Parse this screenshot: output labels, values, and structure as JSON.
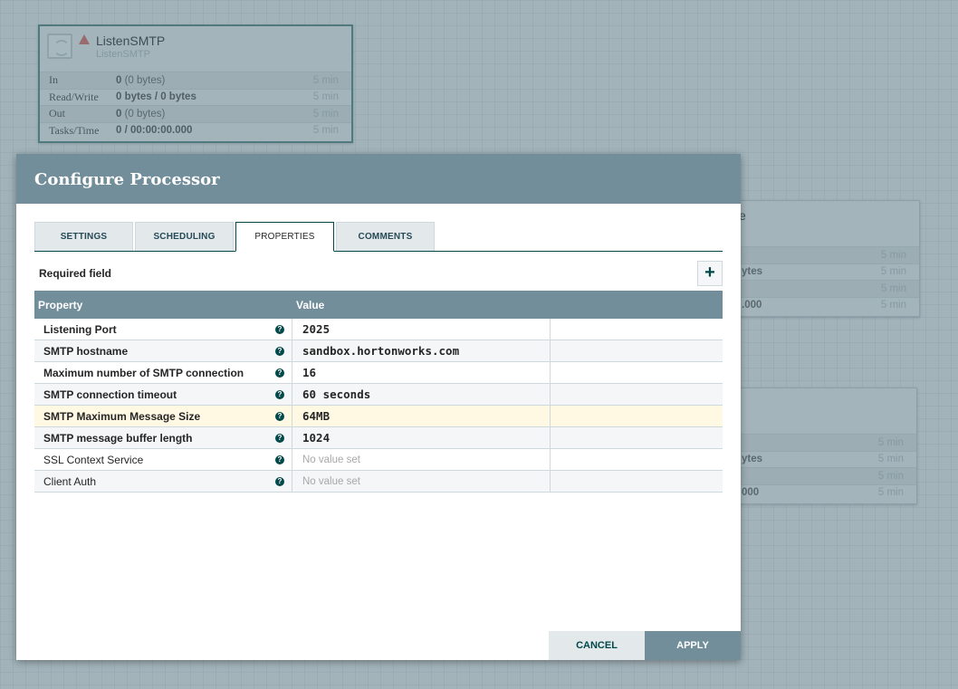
{
  "canvas": {
    "processors": [
      {
        "name": "ListenSMTP",
        "type": "ListenSMTP",
        "warning": true,
        "stats": [
          {
            "label": "In",
            "value_bold": "0",
            "value_rest": " (0 bytes)",
            "time": "5 min"
          },
          {
            "label": "Read/Write",
            "value_bold": "0 bytes / 0 bytes",
            "value_rest": "",
            "time": "5 min"
          },
          {
            "label": "Out",
            "value_bold": "0",
            "value_rest": " (0 bytes)",
            "time": "5 min"
          },
          {
            "label": "Tasks/Time",
            "value_bold": "0 / 00:00:00.000",
            "value_rest": "",
            "time": "5 min"
          }
        ]
      },
      {
        "name_fragment": "e",
        "stats": [
          {
            "value": "",
            "time": "5 min"
          },
          {
            "value": "ytes",
            "time": "5 min"
          },
          {
            "value": "",
            "time": "5 min"
          },
          {
            "value": ".000",
            "time": "5 min"
          }
        ]
      },
      {
        "stats": [
          {
            "value": "",
            "time": "5 min"
          },
          {
            "value": "ytes",
            "time": "5 min"
          },
          {
            "value": "",
            "time": "5 min"
          },
          {
            "value": "000",
            "time": "5 min"
          }
        ]
      }
    ]
  },
  "dialog": {
    "title": "Configure Processor",
    "tabs": [
      {
        "label": "SETTINGS",
        "active": false
      },
      {
        "label": "SCHEDULING",
        "active": false
      },
      {
        "label": "PROPERTIES",
        "active": true
      },
      {
        "label": "COMMENTS",
        "active": false
      }
    ],
    "required_label": "Required field",
    "add_icon": "+",
    "grid": {
      "headers": {
        "property": "Property",
        "value": "Value"
      },
      "help_glyph": "?",
      "rows": [
        {
          "name": "Listening Port",
          "value": "2025",
          "required": true
        },
        {
          "name": "SMTP hostname",
          "value": "sandbox.hortonworks.com",
          "required": true
        },
        {
          "name": "Maximum number of SMTP connection",
          "value": "16",
          "required": true
        },
        {
          "name": "SMTP connection timeout",
          "value": "60 seconds",
          "required": true
        },
        {
          "name": "SMTP Maximum Message Size",
          "value": "64MB",
          "required": true,
          "highlighted": true
        },
        {
          "name": "SMTP message buffer length",
          "value": "1024",
          "required": true
        },
        {
          "name": "SSL Context Service",
          "value": "No value set",
          "required": false,
          "empty": true
        },
        {
          "name": "Client Auth",
          "value": "No value set",
          "required": false,
          "empty": true
        }
      ]
    },
    "buttons": {
      "cancel": "CANCEL",
      "apply": "APPLY"
    }
  }
}
